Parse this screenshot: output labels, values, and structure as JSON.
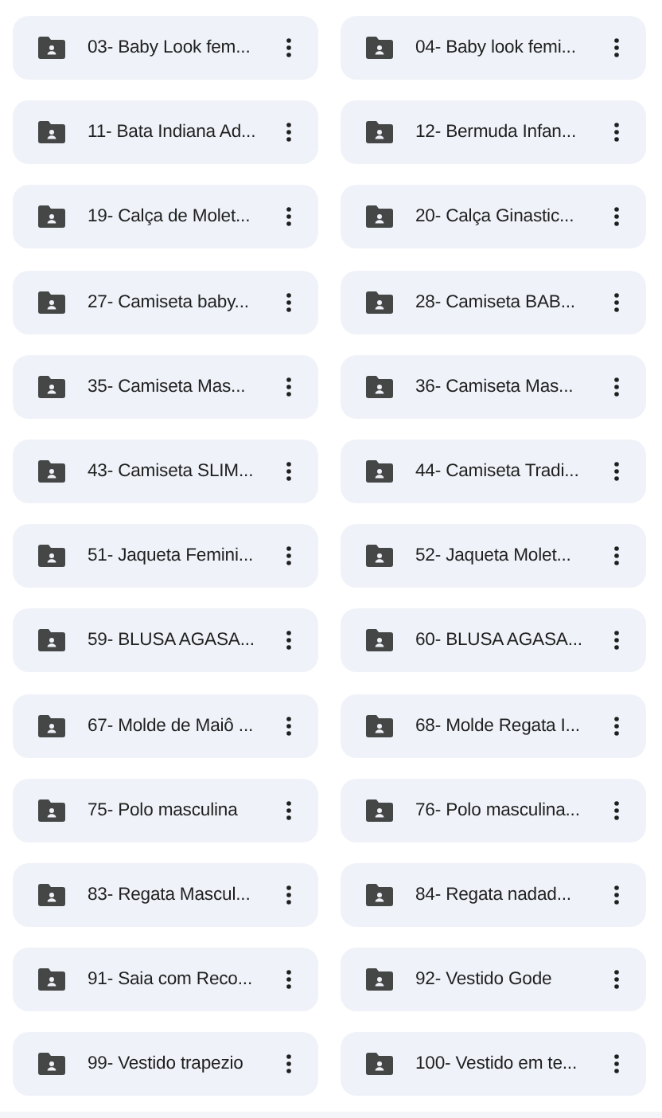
{
  "folders": [
    {
      "name": "03- Baby Look fem..."
    },
    {
      "name": "04- Baby look femi..."
    },
    {
      "name": "11- Bata Indiana Ad..."
    },
    {
      "name": "12- Bermuda Infan..."
    },
    {
      "name": "19- Calça de Molet..."
    },
    {
      "name": "20- Calça Ginastic..."
    },
    {
      "name": "27- Camiseta baby..."
    },
    {
      "name": "28- Camiseta BAB..."
    },
    {
      "name": "35- Camiseta Mas..."
    },
    {
      "name": "36- Camiseta Mas..."
    },
    {
      "name": "43- Camiseta SLIM..."
    },
    {
      "name": "44- Camiseta Tradi..."
    },
    {
      "name": "51- Jaqueta Femini..."
    },
    {
      "name": "52- Jaqueta Molet..."
    },
    {
      "name": "59- BLUSA AGASA..."
    },
    {
      "name": "60- BLUSA AGASA..."
    },
    {
      "name": "67- Molde de Maiô ..."
    },
    {
      "name": "68- Molde Regata I..."
    },
    {
      "name": "75- Polo masculina"
    },
    {
      "name": "76- Polo masculina..."
    },
    {
      "name": "83- Regata Mascul..."
    },
    {
      "name": "84- Regata nadad..."
    },
    {
      "name": "91- Saia com Reco..."
    },
    {
      "name": "92- Vestido Gode"
    },
    {
      "name": "99- Vestido trapezio"
    },
    {
      "name": "100- Vestido em te..."
    }
  ]
}
